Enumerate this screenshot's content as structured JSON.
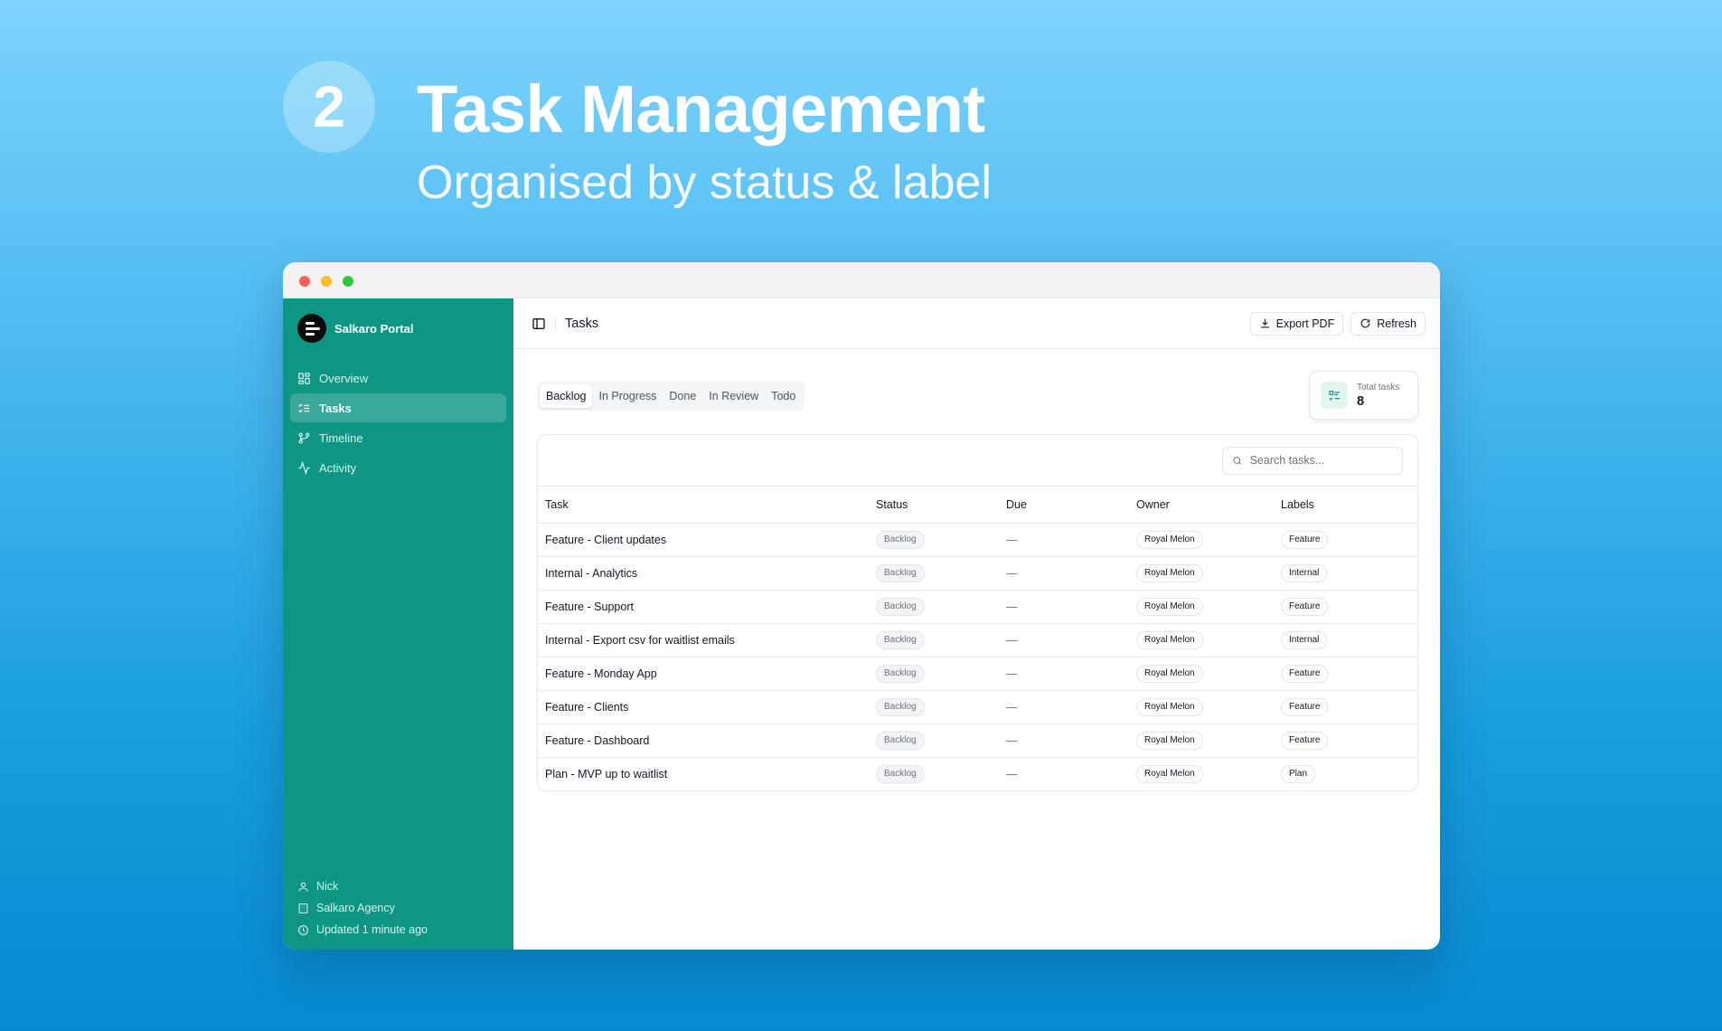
{
  "hero": {
    "number": "2",
    "title": "Task Management",
    "subtitle": "Organised by status & label"
  },
  "sidebar": {
    "brand": "Salkaro Portal",
    "items": [
      {
        "label": "Overview",
        "icon": "grid-icon"
      },
      {
        "label": "Tasks",
        "icon": "list-checks-icon",
        "active": true
      },
      {
        "label": "Timeline",
        "icon": "git-branch-icon"
      },
      {
        "label": "Activity",
        "icon": "activity-icon"
      }
    ],
    "footer": {
      "user": "Nick",
      "agency": "Salkaro Agency",
      "updated": "Updated 1 minute ago"
    }
  },
  "topbar": {
    "title": "Tasks",
    "export_label": "Export PDF",
    "refresh_label": "Refresh"
  },
  "tabs": [
    "Backlog",
    "In Progress",
    "Done",
    "In Review",
    "Todo"
  ],
  "active_tab": "Backlog",
  "stat": {
    "label": "Total tasks",
    "value": "8"
  },
  "search": {
    "placeholder": "Search tasks..."
  },
  "table": {
    "headers": [
      "Task",
      "Status",
      "Due",
      "Owner",
      "Labels"
    ],
    "rows": [
      {
        "task": "Feature - Client updates",
        "status": "Backlog",
        "due": "—",
        "owner": "Royal Melon",
        "label": "Feature"
      },
      {
        "task": "Internal - Analytics",
        "status": "Backlog",
        "due": "—",
        "owner": "Royal Melon",
        "label": "Internal"
      },
      {
        "task": "Feature - Support",
        "status": "Backlog",
        "due": "—",
        "owner": "Royal Melon",
        "label": "Feature"
      },
      {
        "task": "Internal - Export csv for waitlist emails",
        "status": "Backlog",
        "due": "—",
        "owner": "Royal Melon",
        "label": "Internal"
      },
      {
        "task": "Feature - Monday App",
        "status": "Backlog",
        "due": "—",
        "owner": "Royal Melon",
        "label": "Feature"
      },
      {
        "task": "Feature - Clients",
        "status": "Backlog",
        "due": "—",
        "owner": "Royal Melon",
        "label": "Feature"
      },
      {
        "task": "Feature - Dashboard",
        "status": "Backlog",
        "due": "—",
        "owner": "Royal Melon",
        "label": "Feature"
      },
      {
        "task": "Plan - MVP up to waitlist",
        "status": "Backlog",
        "due": "—",
        "owner": "Royal Melon",
        "label": "Plan"
      }
    ]
  },
  "colors": {
    "sidebar": "#0f9584",
    "background_top": "#7dd3fc",
    "background_bottom": "#0789cf"
  }
}
